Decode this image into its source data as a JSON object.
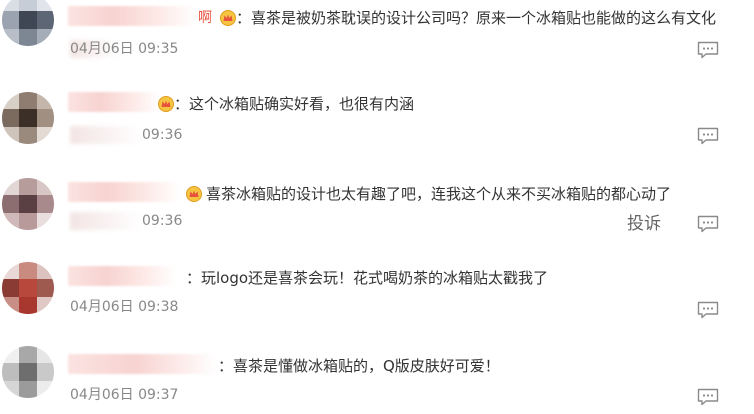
{
  "comments": [
    {
      "suffix": "啊",
      "text": "：喜茶是被奶茶耽误的设计公司吗？原来一个冰箱贴也能做的这么有文化",
      "time": "04月06日 09:35"
    },
    {
      "text": "：这个冰箱贴确实好看，也很有内涵",
      "time": "09:36"
    },
    {
      "text": "喜茶冰箱贴的设计也太有趣了吧，连我这个从来不买冰箱贴的都心动了",
      "time": "09:36",
      "report": "投诉"
    },
    {
      "text": "：玩logo还是喜茶会玩！花式喝奶茶的冰箱贴太戳我了",
      "time": "04月06日 09:38"
    },
    {
      "text": "：喜茶是懂做冰箱贴的，Q版皮肤好可爱！",
      "time": "04月06日 09:37"
    }
  ],
  "icons": {
    "reply": "comment-bubble-icon",
    "crown": "crown-badge-icon"
  }
}
